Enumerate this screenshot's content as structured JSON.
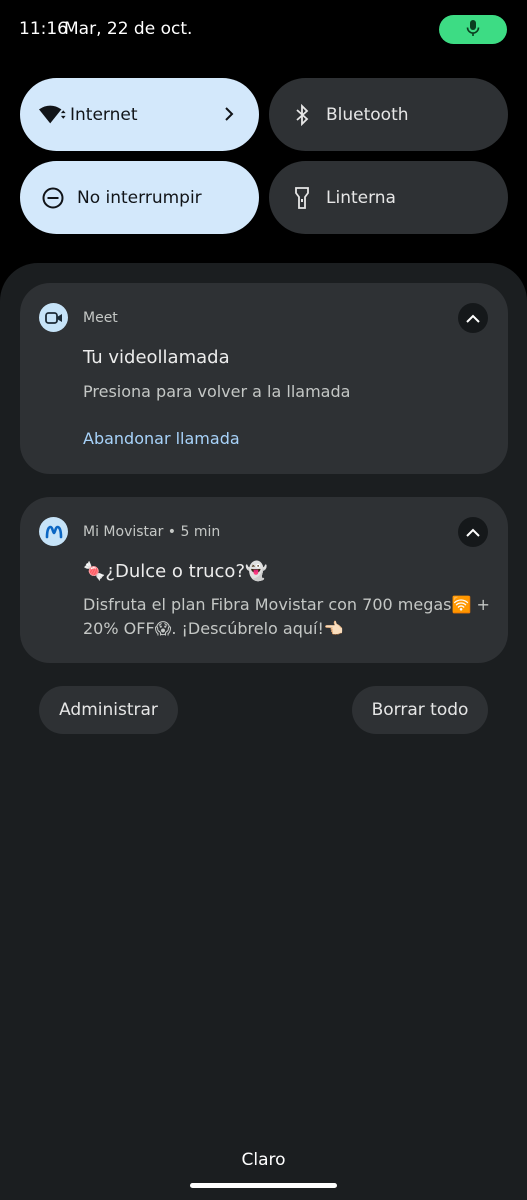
{
  "status_bar": {
    "time": "11:16",
    "date": "Mar, 22 de oct."
  },
  "quick_tiles": [
    {
      "label": "Internet",
      "icon": "wifi-icon",
      "active": true
    },
    {
      "label": "Bluetooth",
      "icon": "bluetooth-icon",
      "active": false
    },
    {
      "label": "No interrumpir",
      "icon": "do-not-disturb-icon",
      "active": true
    },
    {
      "label": "Linterna",
      "icon": "flashlight-icon",
      "active": false
    }
  ],
  "notifications": [
    {
      "app": "Meet",
      "title": "Tu videollamada",
      "body": "Presiona para volver a la llamada",
      "action": "Abandonar llamada",
      "icon": "video-call-icon"
    },
    {
      "app": "Mi Movistar • 5 min",
      "title": "🍬¿Dulce o truco?👻",
      "body": "Disfruta el plan Fibra Movistar con 700 megas🛜 + 20% OFF😱. ¡Descúbrelo aquí!👈🏻",
      "icon": "movistar-icon"
    }
  ],
  "buttons": {
    "manage": "Administrar",
    "clear_all": "Borrar todo"
  },
  "carrier": "Claro",
  "colors": {
    "tile_active": "#d3e8fb",
    "tile_inactive": "#2e3134",
    "shade_bg": "#1b1e20",
    "card_bg": "#2e3134",
    "mic_pill": "#3ddc84",
    "action_link": "#a8d3fa"
  }
}
